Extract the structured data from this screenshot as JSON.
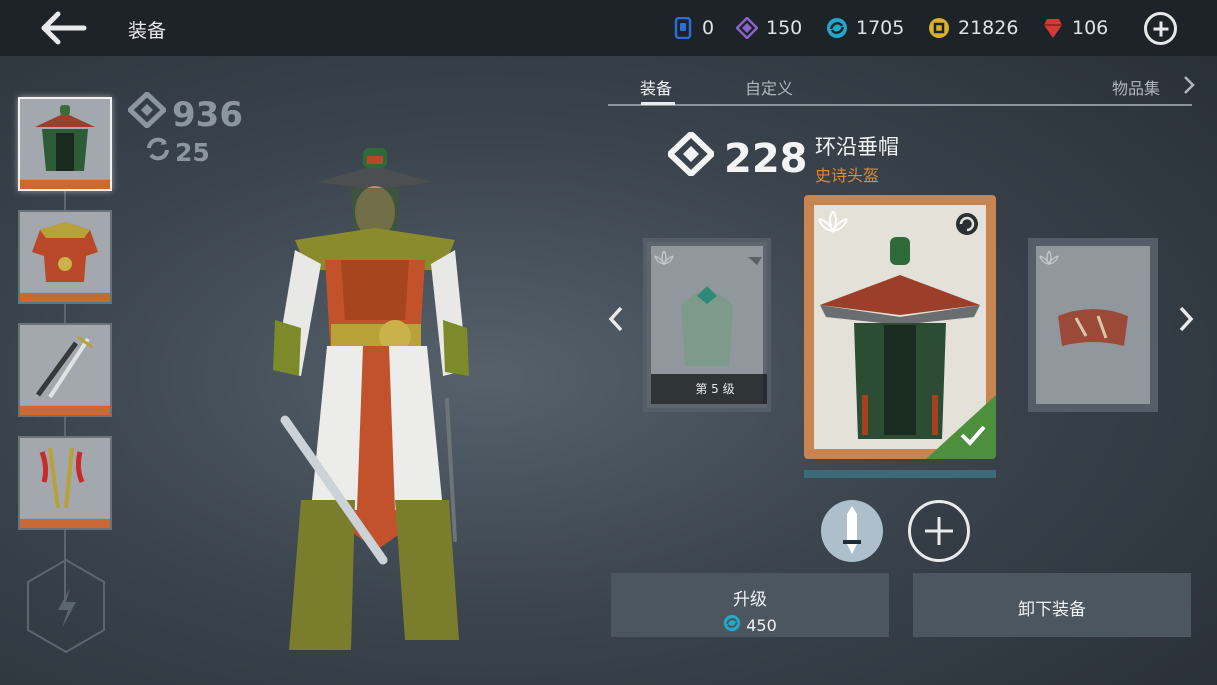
{
  "header": {
    "title": "装备",
    "currencies": [
      {
        "icon": "card-icon",
        "value": "0",
        "color": "#2a6fd6"
      },
      {
        "icon": "purple-gem-icon",
        "value": "150",
        "color": "#8a63c9"
      },
      {
        "icon": "blue-orb-icon",
        "value": "1705",
        "color": "#22a9c9"
      },
      {
        "icon": "gold-coin-icon",
        "value": "21826",
        "color": "#d8b228"
      },
      {
        "icon": "red-ruby-icon",
        "value": "106",
        "color": "#d23b33"
      }
    ]
  },
  "stats": {
    "power": "936",
    "refresh": "25"
  },
  "slots": [
    {
      "name": "helmet-slot",
      "active": true
    },
    {
      "name": "armor-slot",
      "active": false
    },
    {
      "name": "weapon-slot",
      "active": false
    },
    {
      "name": "ranged-slot",
      "active": false
    }
  ],
  "tabs": [
    {
      "label": "装备",
      "active": true
    },
    {
      "label": "自定义",
      "active": false
    },
    {
      "label": "物品集",
      "active": false
    }
  ],
  "item": {
    "power": "228",
    "name": "环沿垂帽",
    "rarity": "史诗头盔",
    "rarity_color": "#d98b3a"
  },
  "cards": {
    "left_level": "第 5 级"
  },
  "actions": {
    "upgrade_label": "升级",
    "upgrade_cost": "450",
    "unequip_label": "卸下装备"
  }
}
